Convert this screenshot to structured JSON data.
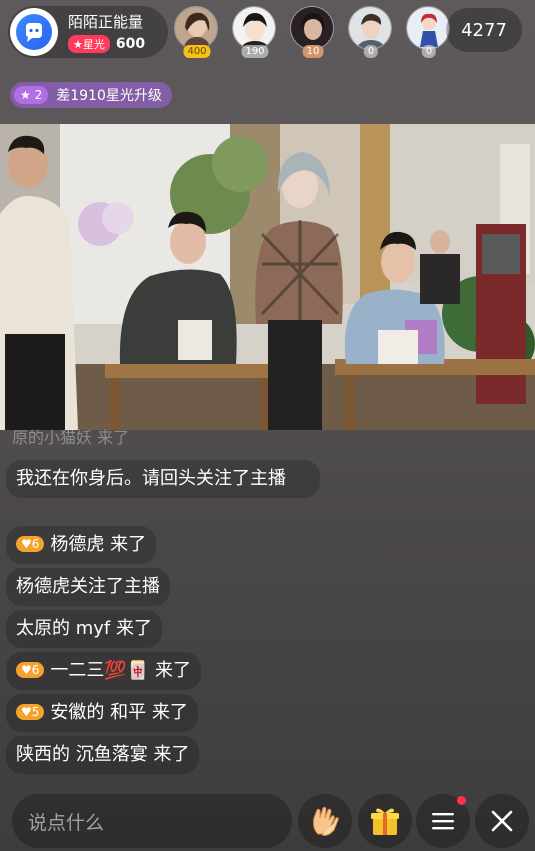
{
  "header": {
    "host_name": "陌陌正能量",
    "star_label": "星光",
    "star_count": "600",
    "viewers": [
      {
        "count": "400",
        "style": "gold"
      },
      {
        "count": "190",
        "style": "silver"
      },
      {
        "count": "10",
        "style": "bronze"
      },
      {
        "count": "0",
        "style": "silver"
      },
      {
        "count": "0",
        "style": "silver"
      }
    ],
    "total_viewers": "4277"
  },
  "level_bar": {
    "level": "2",
    "text": "差1910星光升级"
  },
  "chat": {
    "faded_line": "原的小猫妖 来了",
    "messages": [
      {
        "level": "",
        "text": "我还在你身后。请回头关注了主播"
      },
      {
        "level": "6",
        "text": "杨德虎 来了"
      },
      {
        "level": "",
        "text": "杨德虎关注了主播"
      },
      {
        "level": "",
        "text": "太原的 myf 来了"
      },
      {
        "level": "6",
        "text": "一二三💯🀄 来了"
      },
      {
        "level": "5",
        "text": "安徽的 和平 来了"
      },
      {
        "level": "",
        "text": "陕西的 沉鱼落宴 来了"
      }
    ]
  },
  "bottom_bar": {
    "input_placeholder": "说点什么"
  },
  "colors": {
    "star_badge": "#ff3b5c",
    "level_pill": "#b06fe6",
    "fan_level": "#f3a32b",
    "notify_dot": "#ff3344"
  },
  "icons": {
    "host_logo": "momo-logo-icon",
    "star": "star-icon",
    "heart": "heart-icon",
    "clap": "clap-icon",
    "gift": "gift-icon",
    "menu": "menu-icon",
    "close": "close-icon"
  }
}
